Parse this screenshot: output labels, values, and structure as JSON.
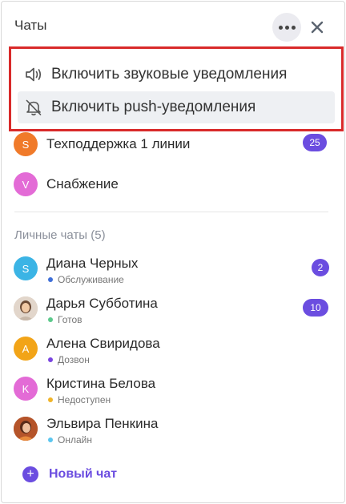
{
  "header": {
    "title": "Чаты",
    "more_icon": "more-horizontal-icon",
    "close_icon": "close-icon"
  },
  "menu": {
    "items": [
      {
        "label": "Включить звуковые уведомления",
        "icon": "speaker-icon"
      },
      {
        "label": "Включить push-уведомления",
        "icon": "bell-off-icon"
      }
    ]
  },
  "group_chats": [
    {
      "initial": "S",
      "name": "Техподдержка 1 линии",
      "badge": "25",
      "color": "#f07a2a"
    },
    {
      "initial": "V",
      "name": "Снабжение",
      "badge": null,
      "color": "#e36bd6"
    }
  ],
  "personal": {
    "title": "Личные чаты (5)",
    "chats": [
      {
        "initial": "S",
        "name": "Диана Черных",
        "status": "Обслуживание",
        "status_color": "#3f6fd8",
        "badge": "2",
        "avatar_color": "#3bb4e5"
      },
      {
        "initial": "",
        "name": "Дарья Субботина",
        "status": "Готов",
        "status_color": "#5cc98b",
        "badge": "10",
        "avatar_color": "photo"
      },
      {
        "initial": "A",
        "name": "Алена Свиридова",
        "status": "Дозвон",
        "status_color": "#7a45e0",
        "badge": null,
        "avatar_color": "#f2a418"
      },
      {
        "initial": "K",
        "name": "Кристина Белова",
        "status": "Недоступен",
        "status_color": "#f0b429",
        "badge": null,
        "avatar_color": "#e36bd6"
      },
      {
        "initial": "",
        "name": "Эльвира Пенкина",
        "status": "Онлайн",
        "status_color": "#5cc6ef",
        "badge": null,
        "avatar_color": "photo"
      }
    ]
  },
  "new_chat": {
    "label": "Новый чат",
    "icon": "plus-icon"
  }
}
